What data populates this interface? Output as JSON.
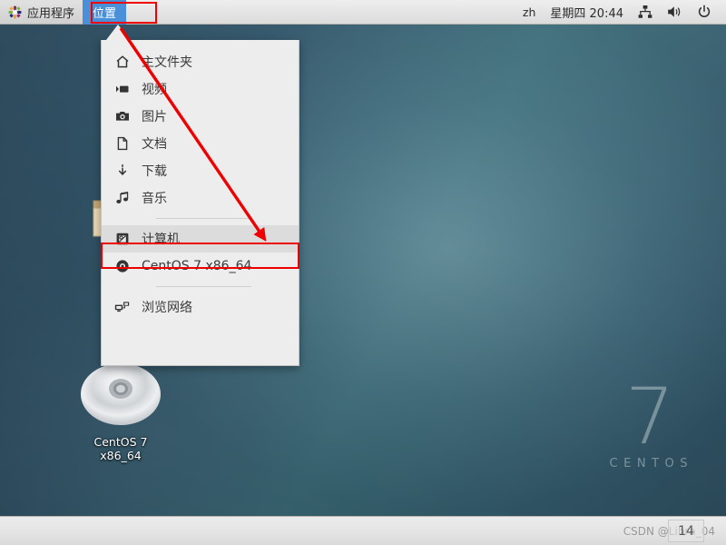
{
  "top_panel": {
    "applications_label": "应用程序",
    "places_label": "位置",
    "keyboard_layout": "zh",
    "clock": "星期四 20:44",
    "network_icon": "network-icon",
    "volume_icon": "volume-icon",
    "power_icon": "power-icon",
    "apps_icon": "centos-pinwheel-icon",
    "highlight_color": "#4a90d9"
  },
  "places_menu": {
    "items": [
      {
        "label": "主文件夹",
        "icon": "home-icon",
        "selected": false
      },
      {
        "label": "视频",
        "icon": "video-icon",
        "selected": false
      },
      {
        "label": "图片",
        "icon": "camera-icon",
        "selected": false
      },
      {
        "label": "文档",
        "icon": "document-icon",
        "selected": false
      },
      {
        "label": "下载",
        "icon": "download-icon",
        "selected": false
      },
      {
        "label": "音乐",
        "icon": "music-note-icon",
        "selected": false
      }
    ],
    "items_group2": [
      {
        "label": "计算机",
        "icon": "computer-icon",
        "selected": true
      },
      {
        "label": "CentOS 7 x86_64",
        "icon": "optical-disc-icon",
        "selected": false
      }
    ],
    "items_group3": [
      {
        "label": "浏览网络",
        "icon": "network-browse-icon",
        "selected": false
      }
    ]
  },
  "desktop": {
    "icons": [
      {
        "name": "trash",
        "label": "",
        "icon": "trash-icon"
      },
      {
        "name": "folder",
        "label": "",
        "icon": "folder-icon"
      },
      {
        "name": "cdrom",
        "label": "CentOS 7 x86_64",
        "icon": "optical-disc-icon"
      }
    ],
    "wallpaper_brand_number": "7",
    "wallpaper_brand_word": "CENTOS"
  },
  "annotations": {
    "places_box_color": "#ee0000",
    "computer_box_color": "#ee0000",
    "arrow_color": "#ee0000"
  },
  "footer": {
    "watermark": "CSDN @Libra_04",
    "page_number": "14"
  }
}
